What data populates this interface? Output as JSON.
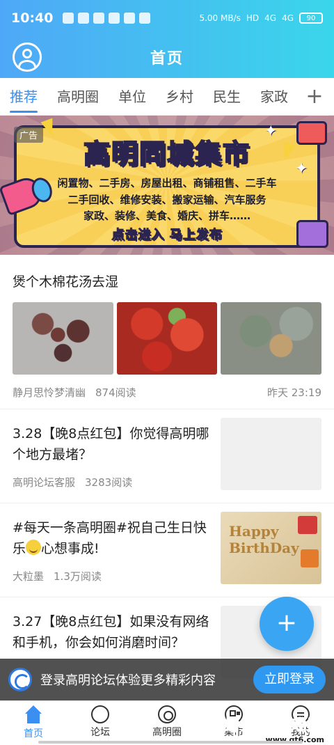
{
  "status": {
    "time": "10:40",
    "net_speed": "5.00 MB/s",
    "net_types": [
      "HD",
      "4G",
      "4G"
    ],
    "battery": "90"
  },
  "header": {
    "title": "首页"
  },
  "tabs": [
    {
      "label": "推荐",
      "active": true
    },
    {
      "label": "高明圈"
    },
    {
      "label": "单位"
    },
    {
      "label": "乡村"
    },
    {
      "label": "民生"
    },
    {
      "label": "家政"
    }
  ],
  "banner": {
    "badge": "广告",
    "title": "高明同城集市",
    "line1": "闲置物、二手房、房屋出租、商铺租售、二手车",
    "line2": "二手回收、维修安装、搬家运输、汽车服务",
    "line3": "家政、装修、美食、婚庆、拼车……",
    "cta": "点击进入  马上发布"
  },
  "posts": [
    {
      "title": "煲个木棉花汤去湿",
      "author": "静月思怜梦清幽",
      "reads": "874阅读",
      "time": "昨天 23:19"
    },
    {
      "title": "3.28【晚8点红包】你觉得高明哪个地方最堵？",
      "author": "高明论坛客服",
      "reads": "3283阅读"
    },
    {
      "title_a": "#每天一条高明圈#祝自己生日快乐",
      "title_b": "心想事成!",
      "author": "大粒墨",
      "reads": "1.3万阅读",
      "image_text_1": "Happy",
      "image_text_2": "BirthDay"
    },
    {
      "title": "3.27【晚8点红包】如果没有网络和手机，你会如何消磨时间？"
    }
  ],
  "login_bar": {
    "text": "登录高明论坛体验更多精彩内容",
    "button": "立即登录"
  },
  "tabbar": [
    {
      "label": "首页",
      "icon": "home-icon",
      "active": true
    },
    {
      "label": "论坛",
      "icon": "forum-icon"
    },
    {
      "label": "高明圈",
      "icon": "circle-icon"
    },
    {
      "label": "集市",
      "icon": "market-icon"
    },
    {
      "label": "我的",
      "icon": "me-icon"
    }
  ],
  "watermark": {
    "line1": "蜻蜓手游戏网",
    "line2": "www.qt6.com"
  },
  "colors": {
    "accent": "#3b8ff0",
    "header_start": "#4fa8f7",
    "header_end": "#3ad6ea",
    "fab": "#3aa6f3"
  }
}
